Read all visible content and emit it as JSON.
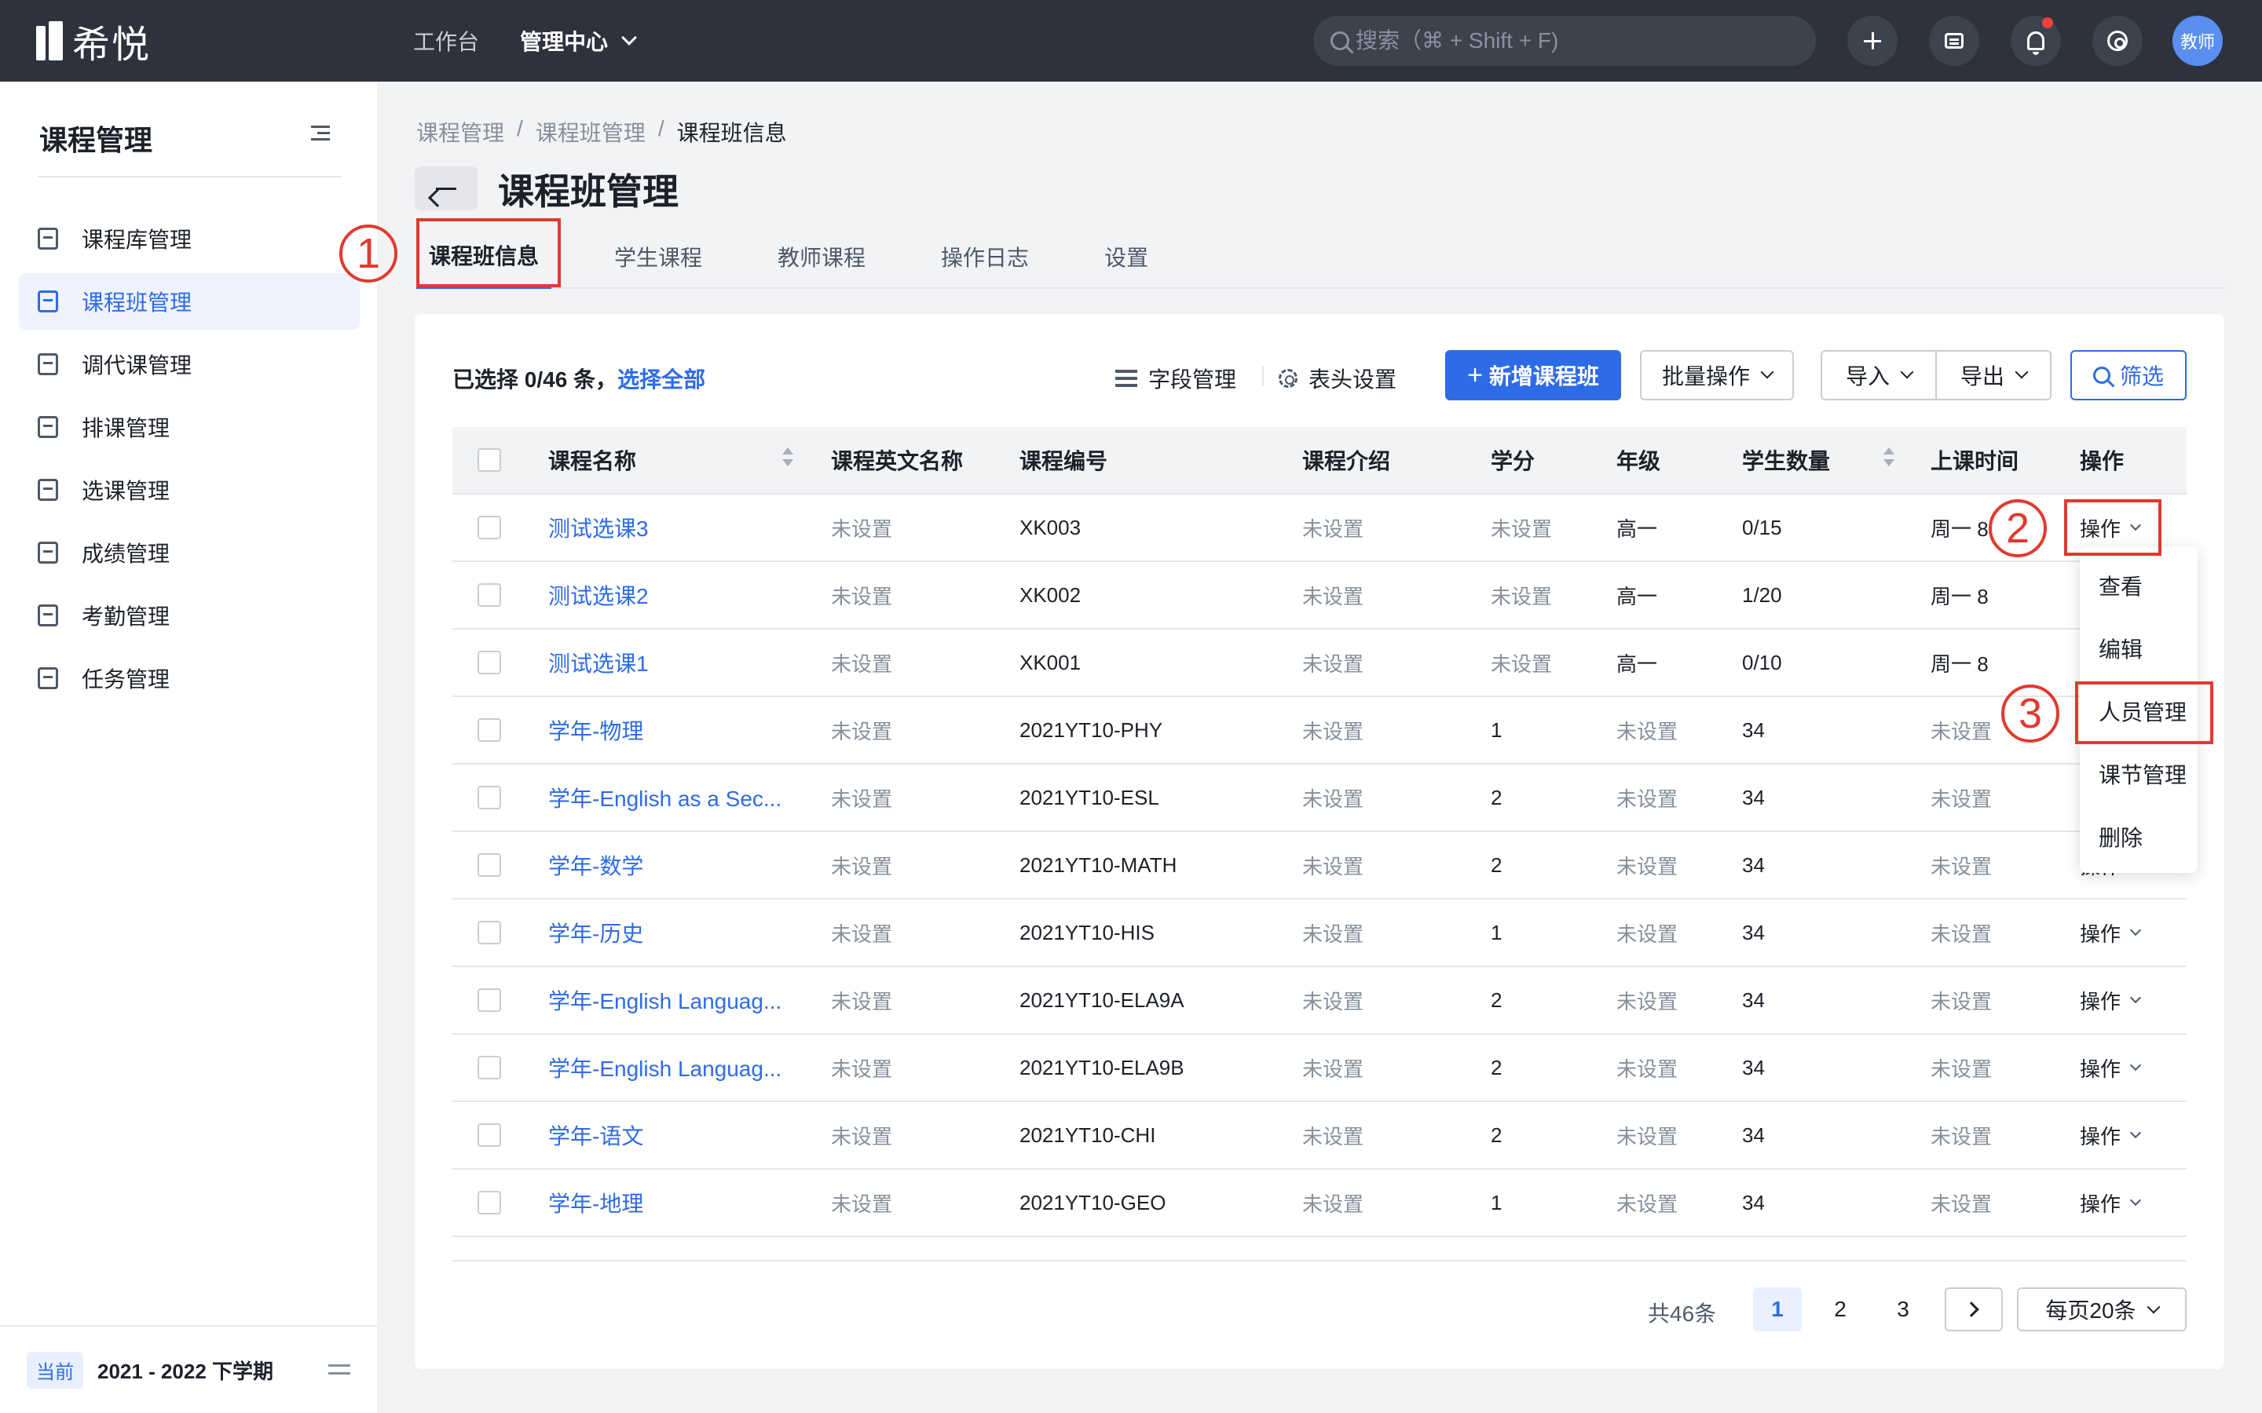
{
  "app": {
    "logo_text": "希悦"
  },
  "topnav": {
    "items": [
      "工作台",
      "管理中心"
    ]
  },
  "search": {
    "placeholder": "搜索（⌘ + Shift + F)"
  },
  "user": {
    "avatar_text": "教师"
  },
  "sidebar": {
    "title": "课程管理",
    "items": [
      {
        "label": "课程库管理"
      },
      {
        "label": "课程班管理"
      },
      {
        "label": "调代课管理"
      },
      {
        "label": "排课管理"
      },
      {
        "label": "选课管理"
      },
      {
        "label": "成绩管理"
      },
      {
        "label": "考勤管理"
      },
      {
        "label": "任务管理"
      }
    ],
    "active_index": 1,
    "footer": {
      "badge": "当前",
      "term": "2021 - 2022 下学期"
    }
  },
  "breadcrumb": [
    "课程管理",
    "/",
    "课程班管理",
    "/",
    "课程班信息"
  ],
  "page": {
    "title": "课程班管理"
  },
  "tabs": [
    "课程班信息",
    "学生课程",
    "教师课程",
    "操作日志",
    "设置"
  ],
  "annotations": [
    "1",
    "2",
    "3"
  ],
  "toolbar": {
    "selection_prefix": "已选择 0/46 条，",
    "select_all": "选择全部",
    "field_manage": "字段管理",
    "header_settings": "表头设置",
    "add_class_plus": "+",
    "add_class": "新增课程班",
    "batch": "批量操作",
    "import": "导入",
    "export": "导出",
    "filter": "筛选"
  },
  "table": {
    "columns": [
      "课程名称",
      "课程英文名称",
      "课程编号",
      "课程介绍",
      "学分",
      "年级",
      "学生数量",
      "上课时间",
      "操作"
    ],
    "op_label": "操作",
    "rows": [
      [
        "测试选课3",
        "未设置",
        "XK003",
        "未设置",
        "未设置",
        "高一",
        "0/15",
        "周一 8"
      ],
      [
        "测试选课2",
        "未设置",
        "XK002",
        "未设置",
        "未设置",
        "高一",
        "1/20",
        "周一 8"
      ],
      [
        "测试选课1",
        "未设置",
        "XK001",
        "未设置",
        "未设置",
        "高一",
        "0/10",
        "周一 8"
      ],
      [
        "学年-物理",
        "未设置",
        "2021YT10-PHY",
        "未设置",
        "1",
        "未设置",
        "34",
        "未设置"
      ],
      [
        "学年-English as a Sec...",
        "未设置",
        "2021YT10-ESL",
        "未设置",
        "2",
        "未设置",
        "34",
        "未设置"
      ],
      [
        "学年-数学",
        "未设置",
        "2021YT10-MATH",
        "未设置",
        "2",
        "未设置",
        "34",
        "未设置"
      ],
      [
        "学年-历史",
        "未设置",
        "2021YT10-HIS",
        "未设置",
        "1",
        "未设置",
        "34",
        "未设置"
      ],
      [
        "学年-English Languag...",
        "未设置",
        "2021YT10-ELA9A",
        "未设置",
        "2",
        "未设置",
        "34",
        "未设置"
      ],
      [
        "学年-English Languag...",
        "未设置",
        "2021YT10-ELA9B",
        "未设置",
        "2",
        "未设置",
        "34",
        "未设置"
      ],
      [
        "学年-语文",
        "未设置",
        "2021YT10-CHI",
        "未设置",
        "2",
        "未设置",
        "34",
        "未设置"
      ],
      [
        "学年-地理",
        "未设置",
        "2021YT10-GEO",
        "未设置",
        "1",
        "未设置",
        "34",
        "未设置"
      ]
    ]
  },
  "dropdown": {
    "items": [
      "查看",
      "编辑",
      "人员管理",
      "课节管理",
      "删除"
    ]
  },
  "pagination": {
    "total": "共46条",
    "pages": [
      "1",
      "2",
      "3"
    ],
    "current": "1",
    "page_size": "每页20条"
  },
  "colors": {
    "accent": "#2e6be6",
    "annotation": "#e03a2f",
    "topbar": "#2d323d"
  }
}
